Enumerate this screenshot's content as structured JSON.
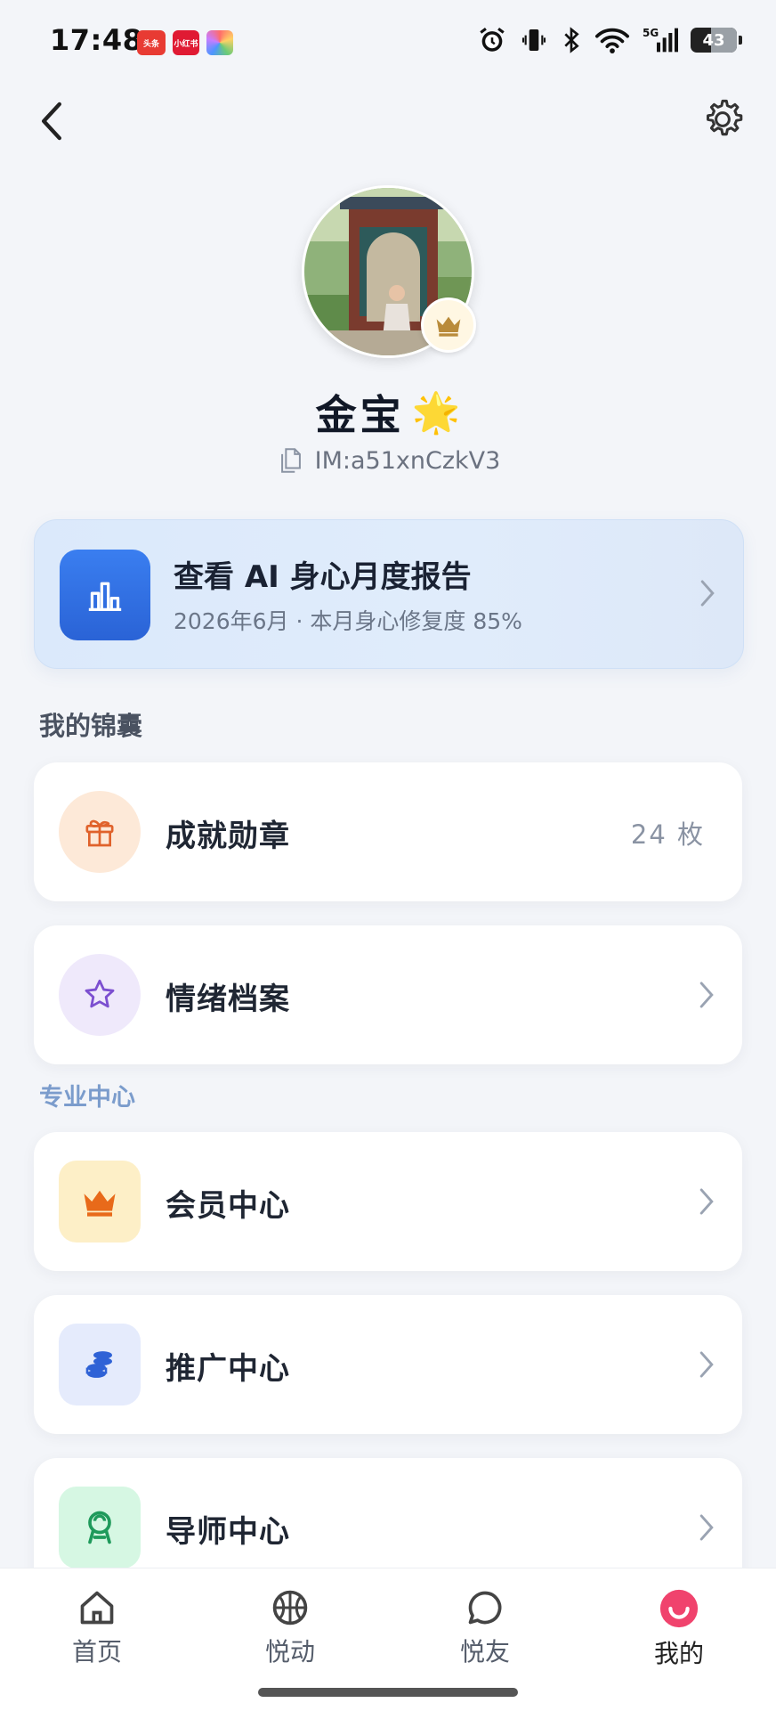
{
  "status_bar": {
    "time": "17:48",
    "app_badges": [
      "头条",
      "小红书",
      ""
    ],
    "battery": "43"
  },
  "profile": {
    "name": "金宝",
    "name_emoji": "🌟",
    "im_id": "IM:a51xnCzkV3"
  },
  "report": {
    "title": "查看 AI 身心月度报告",
    "subtitle": "2026年6月 · 本月身心修复度 85%"
  },
  "sections": {
    "pouch_title": "我的锦囊",
    "pro_title": "专业中心"
  },
  "pouch_items": [
    {
      "label": "成就勋章",
      "value": "24 枚",
      "icon": "gift-icon",
      "icon_bg": "#fde9d8",
      "icon_color": "#e0622b"
    },
    {
      "label": "情绪档案",
      "icon": "star-icon",
      "icon_bg": "#efe9fb",
      "icon_color": "#7c4fd0"
    }
  ],
  "pro_items": [
    {
      "label": "会员中心",
      "icon": "crown-icon",
      "icon_bg": "#fdefc7",
      "icon_color": "#e86a1a"
    },
    {
      "label": "推广中心",
      "icon": "coins-icon",
      "icon_bg": "#e5ebfc",
      "icon_color": "#2f62d6"
    },
    {
      "label": "导师中心",
      "icon": "mentor-icon",
      "icon_bg": "#d6f7e3",
      "icon_color": "#1f9a5b"
    }
  ],
  "tabs": [
    {
      "label": "首页",
      "icon": "home-icon"
    },
    {
      "label": "悦动",
      "icon": "basketball-icon"
    },
    {
      "label": "悦友",
      "icon": "chat-bubble-icon"
    },
    {
      "label": "我的",
      "icon": "smile-face-icon",
      "active": true
    }
  ],
  "colors": {
    "accent_blue": "#2f6fe8",
    "active_tab": "#f0436d",
    "background": "#f3f5f9"
  }
}
